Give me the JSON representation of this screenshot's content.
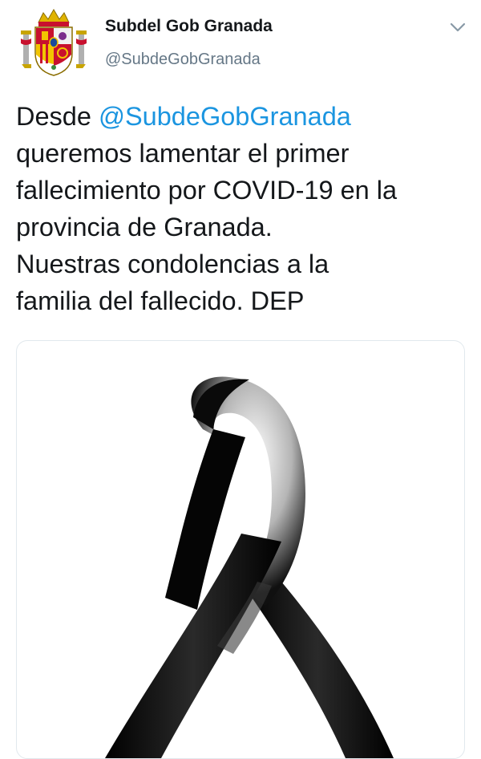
{
  "account": {
    "display_name": "Subdel Gob Granada",
    "handle": "@SubdeGobGranada",
    "avatar_icon": "spanish-coat-of-arms-icon"
  },
  "menu": {
    "icon": "chevron-down-icon"
  },
  "tweet": {
    "line1_prefix": "Desde ",
    "mention": "@SubdeGobGranada",
    "lines": [
      "queremos lamentar el primer",
      "fallecimiento por COVID-19 en la",
      "provincia de Granada.",
      "Nuestras condolencias a la",
      "familia del fallecido. DEP"
    ]
  },
  "media": {
    "icon": "mourning-ribbon-icon"
  },
  "colors": {
    "text": "#14171a",
    "secondary": "#657786",
    "link": "#1b95e0",
    "border": "#e1e8ed"
  }
}
